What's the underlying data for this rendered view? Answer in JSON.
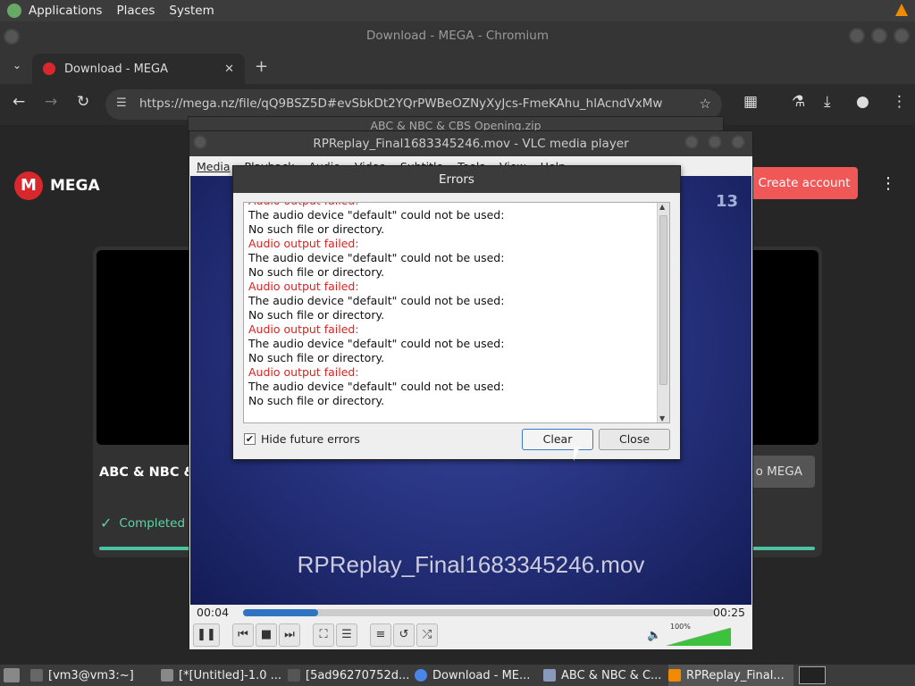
{
  "top_panel": {
    "menus": [
      "Applications",
      "Places",
      "System"
    ]
  },
  "chrome": {
    "window_title": "Download - MEGA - Chromium",
    "tab_title": "Download - MEGA",
    "url": "https://mega.nz/file/qQ9BSZ5D#evSbkDt2YQrPWBeOZNyXyJcs-FmeKAhu_hlAcndVxMw"
  },
  "mega": {
    "logo_letter": "M",
    "logo_text": "MEGA",
    "create_account": "Create account",
    "card_title": "ABC & NBC &",
    "completed": "Completed",
    "to_mega": "o MEGA"
  },
  "vlc_behind": {
    "title": "ABC & NBC & CBS Opening.zip"
  },
  "vlc": {
    "title": "RPReplay_Final1683345246.mov - VLC media player",
    "menus": [
      "Media",
      "Playback",
      "Audio",
      "Video",
      "Subtitle",
      "Tools",
      "View",
      "Help"
    ],
    "video_caption": "RPReplay_Final1683345246.mov",
    "channel_logo": "13",
    "elapsed": "00:04",
    "total": "00:25",
    "progress": 0.16,
    "volume_label": "100%",
    "volume": 1.0
  },
  "errors_dialog": {
    "title": "Errors",
    "log": [
      {
        "text": "Audio output failed:",
        "error": true
      },
      {
        "text": "The audio device \"default\" could not be used:",
        "error": false
      },
      {
        "text": "No such file or directory.",
        "error": false
      },
      {
        "text": "Audio output failed:",
        "error": true
      },
      {
        "text": "The audio device \"default\" could not be used:",
        "error": false
      },
      {
        "text": "No such file or directory.",
        "error": false
      },
      {
        "text": "Audio output failed:",
        "error": true
      },
      {
        "text": "The audio device \"default\" could not be used:",
        "error": false
      },
      {
        "text": "No such file or directory.",
        "error": false
      },
      {
        "text": "Audio output failed:",
        "error": true
      },
      {
        "text": "The audio device \"default\" could not be used:",
        "error": false
      },
      {
        "text": "No such file or directory.",
        "error": false
      },
      {
        "text": "Audio output failed:",
        "error": true
      },
      {
        "text": "The audio device \"default\" could not be used:",
        "error": false
      },
      {
        "text": "No such file or directory.",
        "error": false
      }
    ],
    "hide_future_label": "Hide future errors",
    "hide_future_checked": true,
    "clear_label": "Clear",
    "close_label": "Close"
  },
  "taskbar": {
    "items": [
      {
        "label": "[vm3@vm3:~]",
        "icon": "terminal-icon"
      },
      {
        "label": "[*[Untitled]-1.0 ...",
        "icon": "folder-icon"
      },
      {
        "label": "[5ad96270752d...",
        "icon": "file-icon"
      },
      {
        "label": "Download - ME...",
        "icon": "chromium-icon"
      },
      {
        "label": "ABC & NBC & C...",
        "icon": "archive-icon"
      },
      {
        "label": "RPReplay_Final...",
        "icon": "vlc-icon"
      }
    ]
  },
  "colors": {
    "mega_red": "#d9272e",
    "create_account": "#f05757",
    "completed": "#5fd4a8",
    "vlc_seek": "#2f74c0",
    "error_text": "#e02020"
  }
}
